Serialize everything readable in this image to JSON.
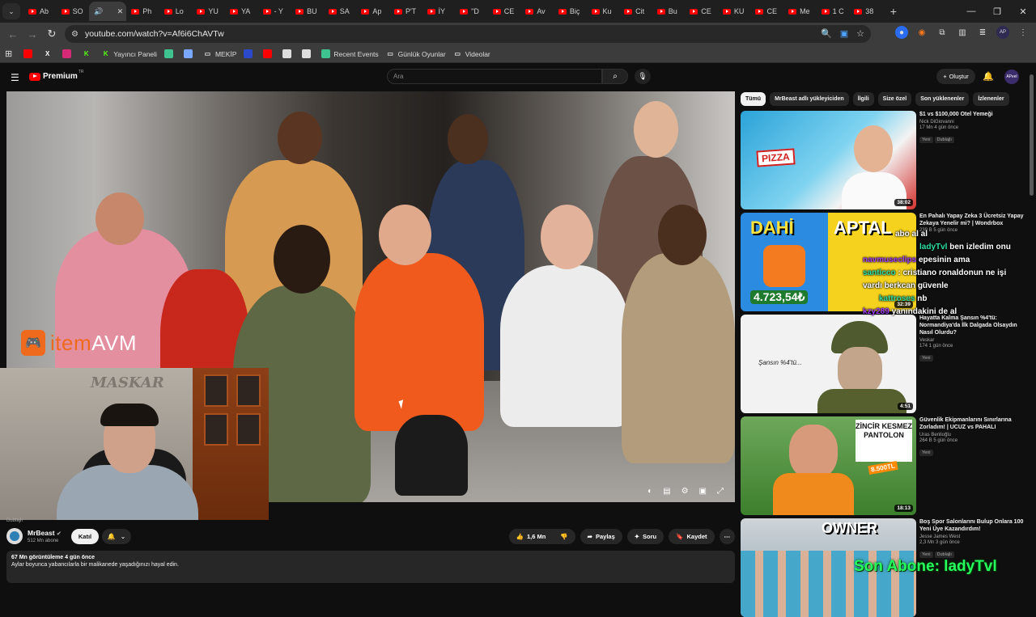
{
  "browser": {
    "tabs": [
      "Ab",
      "SO",
      "",
      "Ph",
      "Lo",
      "YU",
      "YA",
      "- Y",
      "BU",
      "SA",
      "Ap",
      "P'T",
      "İY",
      "\"D",
      "CE",
      "Av",
      "Biç",
      "Ku",
      "Cit",
      "Bu",
      "CE",
      "KU",
      "CE",
      "Me",
      "1 C",
      "38"
    ],
    "active_tab_index": 2,
    "url": "youtube.com/watch?v=Af6i6ChAVTw",
    "bookmarks": [
      {
        "label": "",
        "icon": "youtube-icon",
        "color": "#ff0000"
      },
      {
        "label": "",
        "icon": "x-icon",
        "color": "#ffffff"
      },
      {
        "label": "",
        "icon": "instagram-icon",
        "color": "#d62976"
      },
      {
        "label": "",
        "icon": "kick-icon",
        "color": "#53fc18"
      },
      {
        "label": "Yayıncı Paneli",
        "icon": "kick-icon",
        "color": "#53fc18"
      },
      {
        "label": "",
        "icon": "app-icon",
        "color": "#3ec28f"
      },
      {
        "label": "",
        "icon": "arrow-icon",
        "color": "#7aa7ff"
      },
      {
        "label": "MEKİP",
        "icon": "folder-icon",
        "color": "#dddddd"
      },
      {
        "label": "",
        "icon": "app-icon",
        "color": "#2b4acb"
      },
      {
        "label": "",
        "icon": "youtube-icon",
        "color": "#ff0000"
      },
      {
        "label": "",
        "icon": "image-icon",
        "color": "#dddddd"
      },
      {
        "label": "",
        "icon": "openai-icon",
        "color": "#dddddd"
      },
      {
        "label": "Recent Events",
        "icon": "app-icon",
        "color": "#3ec28f"
      },
      {
        "label": "Günlük Oyunlar",
        "icon": "folder-icon",
        "color": "#dddddd"
      },
      {
        "label": "Videolar",
        "icon": "folder-icon",
        "color": "#dddddd"
      }
    ]
  },
  "youtube": {
    "logo": "Premium",
    "logo_region": "TR",
    "search_placeholder": "Ara",
    "create_label": "Oluştur",
    "avatar_label": "APeel"
  },
  "player": {
    "overlay_brand_a": "item",
    "overlay_brand_b": "AVM",
    "webcam_sign": "MASKAR",
    "dubbed_label": "Dublajlı"
  },
  "channel": {
    "name": "MrBeast",
    "subs": "512 Mn abone",
    "join_label": "Katıl",
    "likes": "1,6 Mn",
    "share_label": "Paylaş",
    "ask_label": "Soru",
    "save_label": "Kaydet"
  },
  "description": {
    "stats": "67 Mn görüntüleme  4 gün önce",
    "text": "Aylar boyunca yabancılarla bir malikanede yaşadığınızı hayal edin."
  },
  "chips": [
    "Tümü",
    "MrBeast adlı yükleyiciden",
    "İlgili",
    "Size özel",
    "Son yüklenenler",
    "İzlenenler"
  ],
  "recommendations": [
    {
      "title": "$1 vs $100,000 Otel Yemeği",
      "channel": "Nick DiGiovanni",
      "stats": "17 Mn  4 gün önce",
      "badges": [
        "Yeni",
        "Dublajlı"
      ],
      "duration": "38:02"
    },
    {
      "title": "En Pahalı Yapay Zeka 3 Ücretsiz Yapay Zekaya Yenelir mi? | Wondrbox",
      "channel": "",
      "stats": "239 B  5 gün önce",
      "badges": [],
      "duration": "32:39"
    },
    {
      "title": "Hayatta Kalma Şansın %4'tü: Normandiya'da İlk Dalgada Olsaydın Nasıl Olurdu?",
      "channel": "Veskar",
      "stats": "174  1 gün önce",
      "badges": [
        "Yeni"
      ],
      "duration": "4:51"
    },
    {
      "title": "Güvenlik Ekipmanlarını Sınırlarına Zorladım! | UCUZ vs PAHALI",
      "channel": "Uras Benlioğlu",
      "stats": "264 B  5 gün önce",
      "badges": [
        "Yeni"
      ],
      "duration": "18:13"
    },
    {
      "title": "Boş Spor Salonlarını Bulup Onlara 100 Yeni Üye Kazandırdım!",
      "channel": "Jesse James West",
      "stats": "2,3 Mn  3 gün önce",
      "badges": [
        "Yeni",
        "Dublajlı"
      ],
      "duration": ""
    }
  ],
  "thumb_text": {
    "pizza": "PIZZA",
    "dahi": "DAHİ",
    "aptal": "APTAL",
    "price": "4.723,54₺",
    "chance": "Şansın %4'tü...",
    "zincir": "ZİNCİR KESMEZ PANTOLON",
    "price2": "8.500TL",
    "owner": "OWNER"
  },
  "chat": [
    {
      "user": "ladyTvl",
      "text": "ben izledim onu"
    },
    {
      "user": "navmuseclips",
      "text": "epesinin ama"
    },
    {
      "user": "santicco",
      "text": ": cristiano ronaldonun ne işi"
    },
    {
      "user": "",
      "text": "vardı berkcan güvenle"
    },
    {
      "user": "kattroses",
      "text": "nb"
    },
    {
      "user": "kzy289",
      "text": "yanındakini de al"
    },
    {
      "user": "",
      "text": "abo al al"
    }
  ],
  "overlay_abone": "Son Abone: ladyTvl"
}
